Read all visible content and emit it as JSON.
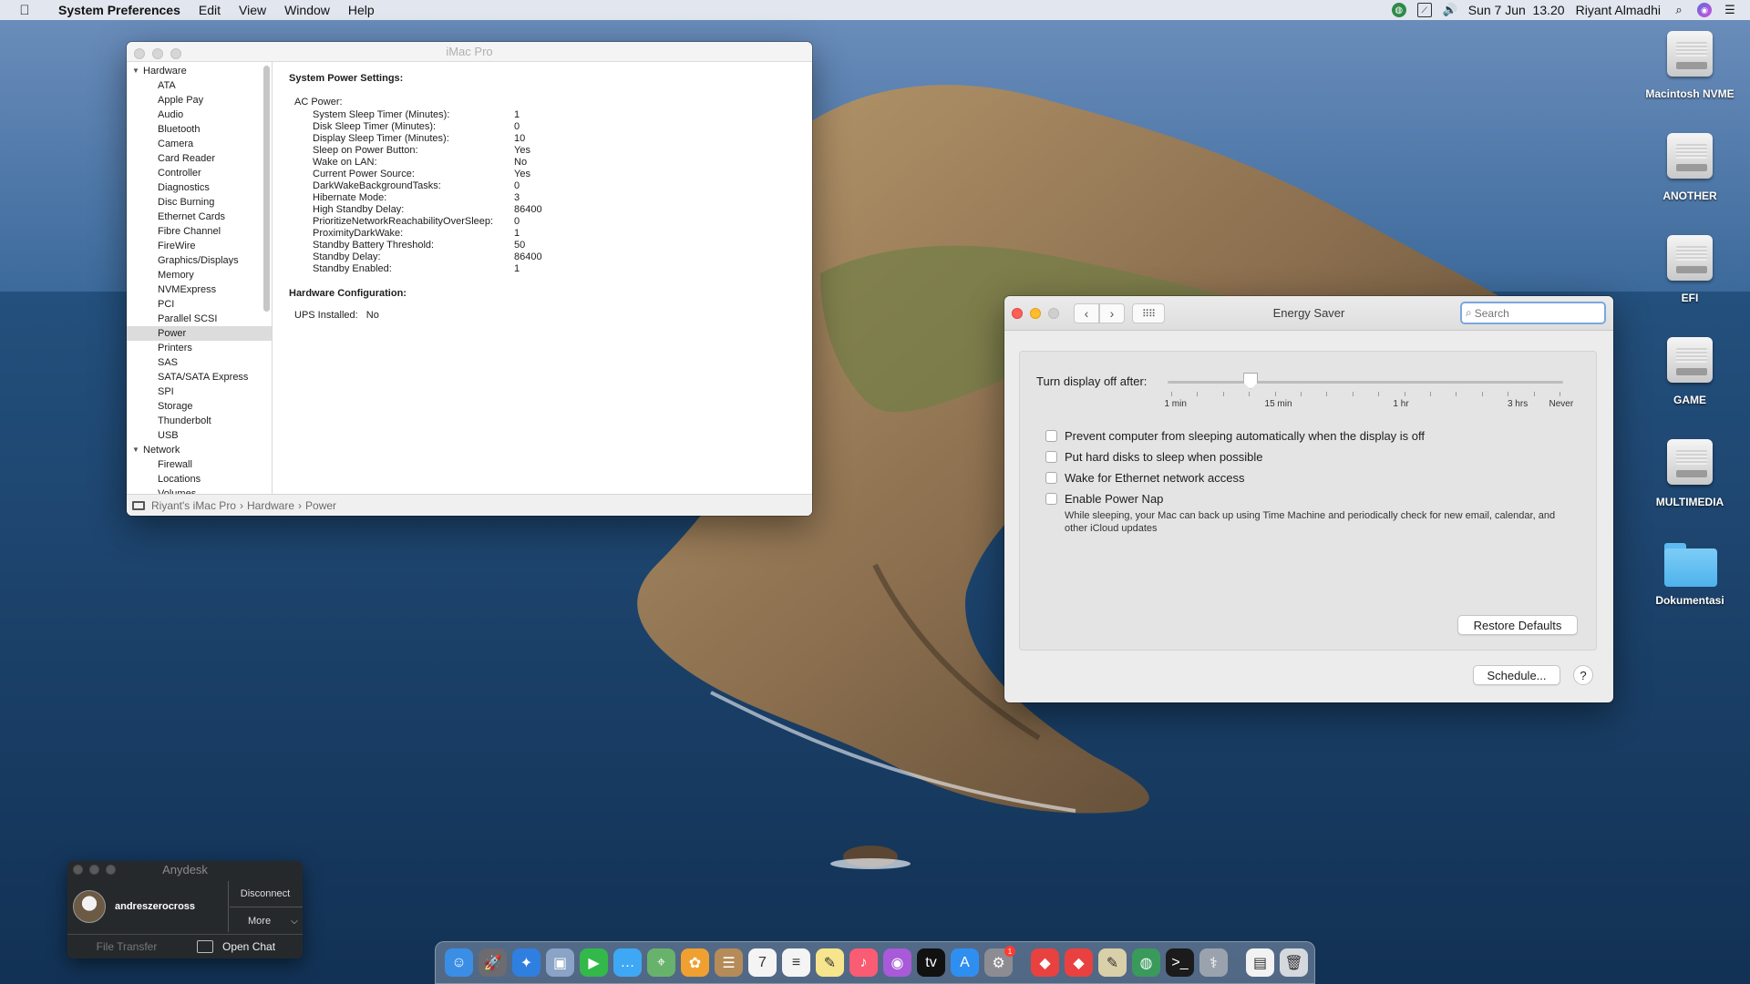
{
  "menubar": {
    "app_name": "System Preferences",
    "menus": [
      "Edit",
      "View",
      "Window",
      "Help"
    ],
    "clock": "Sun 7 Jun  13.20",
    "user": "Riyant Almadhi",
    "status_icons": [
      "globe-icon",
      "activity-monitor-icon",
      "volume-icon",
      "spotlight-icon",
      "siri-icon",
      "notification-center-icon"
    ]
  },
  "sysinfo": {
    "title": "iMac Pro",
    "tree": [
      {
        "label": "Hardware",
        "group": true
      },
      {
        "label": "ATA"
      },
      {
        "label": "Apple Pay"
      },
      {
        "label": "Audio"
      },
      {
        "label": "Bluetooth"
      },
      {
        "label": "Camera"
      },
      {
        "label": "Card Reader"
      },
      {
        "label": "Controller"
      },
      {
        "label": "Diagnostics"
      },
      {
        "label": "Disc Burning"
      },
      {
        "label": "Ethernet Cards"
      },
      {
        "label": "Fibre Channel"
      },
      {
        "label": "FireWire"
      },
      {
        "label": "Graphics/Displays"
      },
      {
        "label": "Memory"
      },
      {
        "label": "NVMExpress"
      },
      {
        "label": "PCI"
      },
      {
        "label": "Parallel SCSI"
      },
      {
        "label": "Power",
        "selected": true
      },
      {
        "label": "Printers"
      },
      {
        "label": "SAS"
      },
      {
        "label": "SATA/SATA Express"
      },
      {
        "label": "SPI"
      },
      {
        "label": "Storage"
      },
      {
        "label": "Thunderbolt"
      },
      {
        "label": "USB"
      },
      {
        "label": "Network",
        "group": true
      },
      {
        "label": "Firewall"
      },
      {
        "label": "Locations"
      },
      {
        "label": "Volumes"
      }
    ],
    "heading": "System Power Settings:",
    "ac_label": "AC Power:",
    "settings": [
      {
        "key": "System Sleep Timer (Minutes):",
        "value": "1"
      },
      {
        "key": "Disk Sleep Timer (Minutes):",
        "value": "0"
      },
      {
        "key": "Display Sleep Timer (Minutes):",
        "value": "10"
      },
      {
        "key": "Sleep on Power Button:",
        "value": "Yes"
      },
      {
        "key": "Wake on LAN:",
        "value": "No"
      },
      {
        "key": "Current Power Source:",
        "value": "Yes"
      },
      {
        "key": "DarkWakeBackgroundTasks:",
        "value": "0"
      },
      {
        "key": "Hibernate Mode:",
        "value": "3"
      },
      {
        "key": "High Standby Delay:",
        "value": "86400"
      },
      {
        "key": "PrioritizeNetworkReachabilityOverSleep:",
        "value": "0"
      },
      {
        "key": "ProximityDarkWake:",
        "value": "1"
      },
      {
        "key": "Standby Battery Threshold:",
        "value": "50"
      },
      {
        "key": "Standby Delay:",
        "value": "86400"
      },
      {
        "key": "Standby Enabled:",
        "value": "1"
      }
    ],
    "hw_heading": "Hardware Configuration:",
    "ups_key": "UPS Installed:",
    "ups_value": "No",
    "breadcrumb": [
      "Riyant's iMac Pro",
      "Hardware",
      "Power"
    ],
    "breadcrumb_sep": "›"
  },
  "energy": {
    "title": "Energy Saver",
    "search_placeholder": "Search",
    "slider_label": "Turn display off after:",
    "slider_value_fraction": 0.21,
    "tick_labels": [
      {
        "text": "1 min",
        "at": 0.02
      },
      {
        "text": "15 min",
        "at": 0.28
      },
      {
        "text": "1 hr",
        "at": 0.59
      },
      {
        "text": "3 hrs",
        "at": 0.885
      },
      {
        "text": "Never",
        "at": 0.995
      }
    ],
    "options": [
      {
        "label": "Prevent computer from sleeping automatically when the display is off",
        "checked": false
      },
      {
        "label": "Put hard disks to sleep when possible",
        "checked": false
      },
      {
        "label": "Wake for Ethernet network access",
        "checked": false
      },
      {
        "label": "Enable Power Nap",
        "checked": false
      }
    ],
    "power_nap_desc": "While sleeping, your Mac can back up using Time Machine and periodically check for new email, calendar, and other iCloud updates",
    "restore_label": "Restore Defaults",
    "schedule_label": "Schedule...",
    "help_label": "?"
  },
  "desktop_icons": [
    {
      "label": "Macintosh NVME",
      "kind": "drive"
    },
    {
      "label": "ANOTHER",
      "kind": "drive"
    },
    {
      "label": "EFI",
      "kind": "drive"
    },
    {
      "label": "GAME",
      "kind": "drive"
    },
    {
      "label": "MULTIMEDIA",
      "kind": "drive"
    },
    {
      "label": "Dokumentasi",
      "kind": "folder"
    }
  ],
  "anydesk": {
    "title": "Anydesk",
    "user": "andreszerocross",
    "disconnect_label": "Disconnect",
    "more_label": "More",
    "file_transfer_label": "File Transfer",
    "open_chat_label": "Open Chat"
  },
  "dock": {
    "apps": [
      {
        "name": "finder-icon",
        "color": "#3a8ee6",
        "glyph": "☺"
      },
      {
        "name": "launchpad-icon",
        "color": "#6b6b70",
        "glyph": "🚀"
      },
      {
        "name": "safari-icon",
        "color": "#2f7fe0",
        "glyph": "✦"
      },
      {
        "name": "preview-icon",
        "color": "#8aa3c6",
        "glyph": "▣"
      },
      {
        "name": "facetime-icon",
        "color": "#33b84a",
        "glyph": "▶"
      },
      {
        "name": "messages-icon",
        "color": "#3fa8f4",
        "glyph": "…"
      },
      {
        "name": "maps-icon",
        "color": "#68b36b",
        "glyph": "⌖"
      },
      {
        "name": "photos-icon",
        "color": "#f0a030",
        "glyph": "✿"
      },
      {
        "name": "contacts-icon",
        "color": "#b58b5a",
        "glyph": "☰"
      },
      {
        "name": "calendar-icon",
        "color": "#f4f4f4",
        "glyph": "7"
      },
      {
        "name": "reminders-icon",
        "color": "#f4f4f4",
        "glyph": "≡"
      },
      {
        "name": "notes-icon",
        "color": "#f6e58d",
        "glyph": "✎"
      },
      {
        "name": "music-icon",
        "color": "#fa5c73",
        "glyph": "♪"
      },
      {
        "name": "podcasts-icon",
        "color": "#a95ad8",
        "glyph": "◉"
      },
      {
        "name": "tv-icon",
        "color": "#111111",
        "glyph": "tv"
      },
      {
        "name": "app-store-icon",
        "color": "#2f8ff0",
        "glyph": "A"
      },
      {
        "name": "system-preferences-icon",
        "color": "#8c8c92",
        "glyph": "⚙",
        "badge": "1"
      },
      {
        "sep": true
      },
      {
        "name": "anydesk-icon",
        "color": "#e9413f",
        "glyph": "◆"
      },
      {
        "name": "anydesk-alt-icon",
        "color": "#e9413f",
        "glyph": "◆"
      },
      {
        "name": "script-editor-icon",
        "color": "#d9cfa8",
        "glyph": "✎"
      },
      {
        "name": "network-utility-icon",
        "color": "#3a9a5c",
        "glyph": "◍"
      },
      {
        "name": "terminal-icon",
        "color": "#1b1b1b",
        "glyph": ">_"
      },
      {
        "name": "disk-utility-icon",
        "color": "#9aa3ad",
        "glyph": "⚕"
      },
      {
        "sep": true
      },
      {
        "name": "document-icon",
        "color": "#f2f2f2",
        "glyph": "▤"
      },
      {
        "name": "trash-icon",
        "color": "#d5d9de",
        "glyph": "🗑"
      }
    ]
  }
}
